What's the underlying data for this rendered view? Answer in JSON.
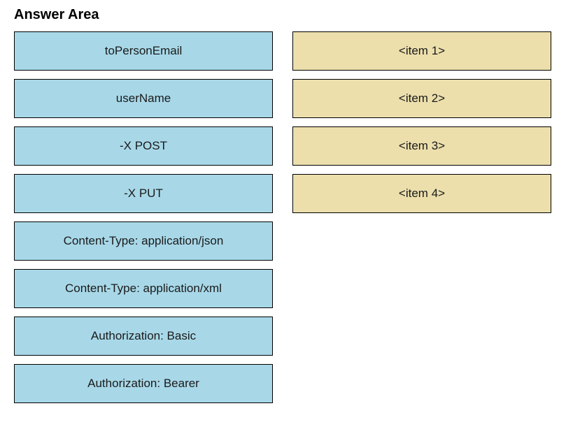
{
  "title": "Answer Area",
  "source_items": [
    "toPersonEmail",
    "userName",
    "-X POST",
    "-X PUT",
    "Content-Type: application/json",
    "Content-Type: application/xml",
    "Authorization: Basic",
    "Authorization: Bearer"
  ],
  "target_items": [
    "<item 1>",
    "<item 2>",
    "<item 3>",
    "<item 4>"
  ]
}
